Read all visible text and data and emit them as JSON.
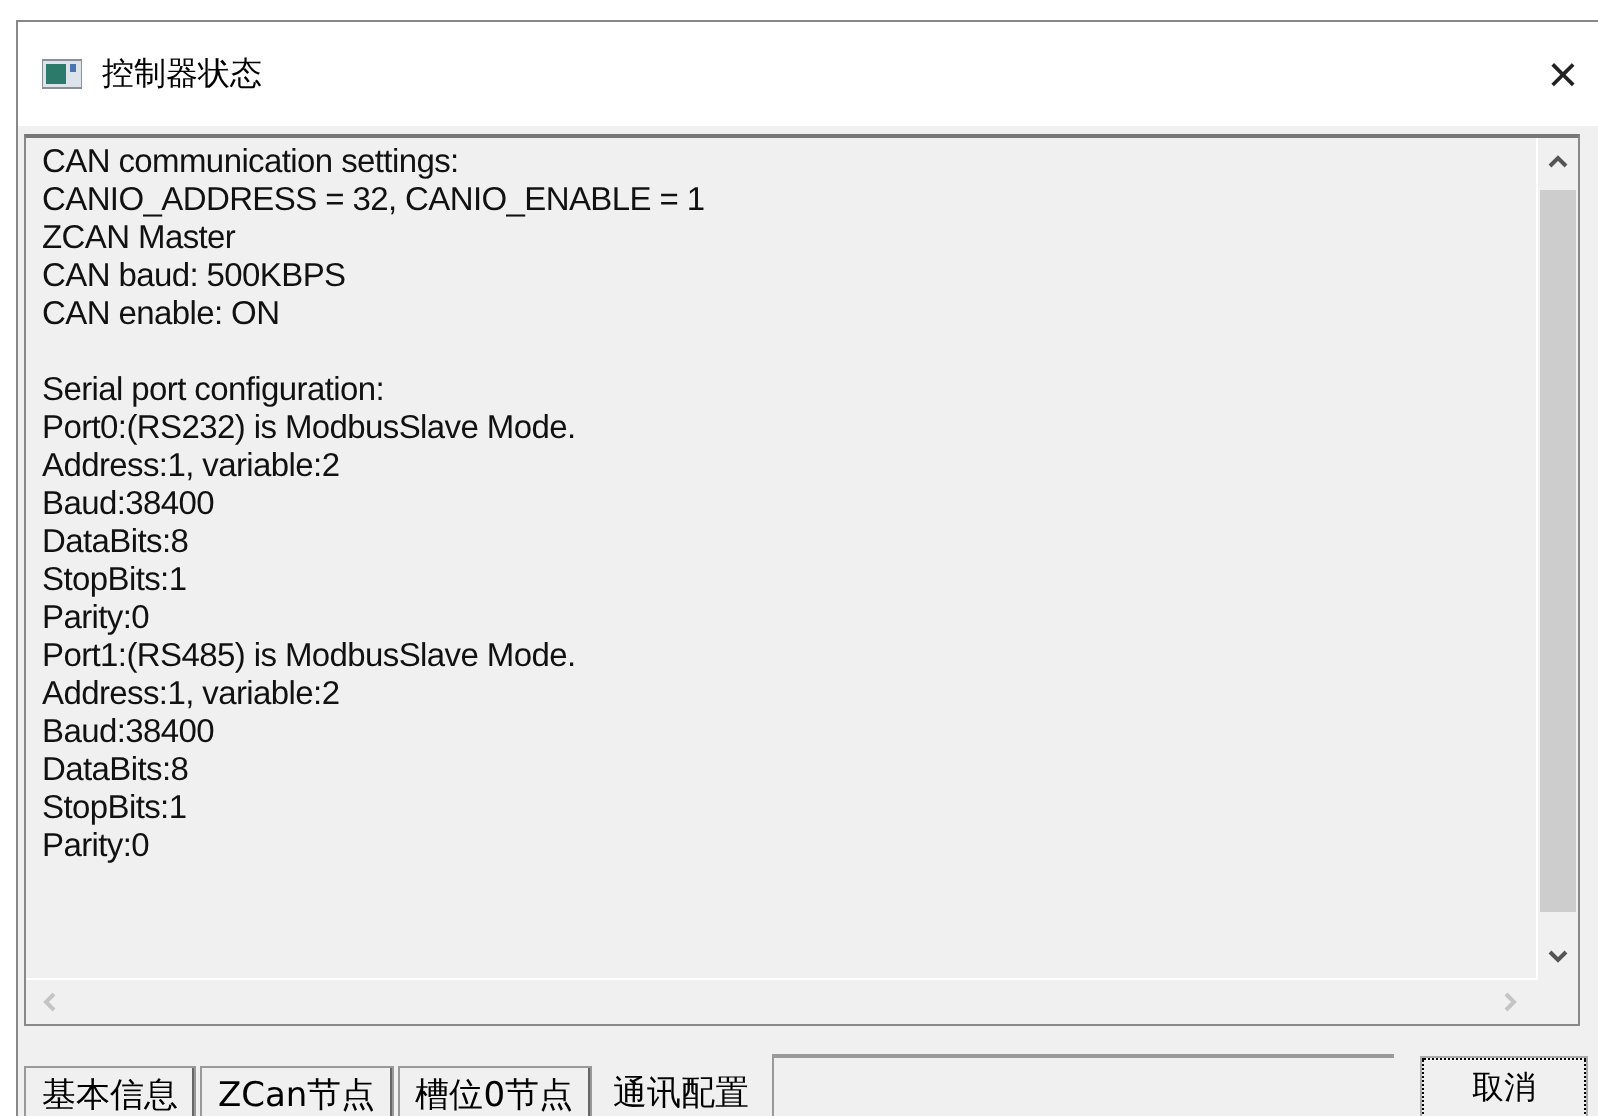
{
  "window": {
    "title": "控制器状态",
    "close": "×"
  },
  "text_box": {
    "sections": [
      {
        "lines": [
          "CAN communication settings:",
          "CANIO_ADDRESS = 32, CANIO_ENABLE = 1",
          "ZCAN Master",
          "CAN baud: 500KBPS",
          "CAN enable: ON"
        ]
      },
      {
        "lines": [
          "Serial port configuration:",
          "Port0:(RS232) is ModbusSlave Mode.",
          "Address:1, variable:2",
          "Baud:38400",
          "DataBits:8",
          "StopBits:1",
          "Parity:0",
          "Port1:(RS485) is ModbusSlave Mode.",
          "Address:1, variable:2",
          "Baud:38400",
          "DataBits:8",
          "StopBits:1",
          "Parity:0"
        ]
      }
    ]
  },
  "tabs": [
    {
      "label": "基本信息",
      "selected": false
    },
    {
      "label": "ZCan节点",
      "selected": false
    },
    {
      "label": "槽位0节点",
      "selected": false
    },
    {
      "label": "通讯配置",
      "selected": true
    }
  ],
  "buttons": [
    {
      "label": "取消"
    }
  ]
}
